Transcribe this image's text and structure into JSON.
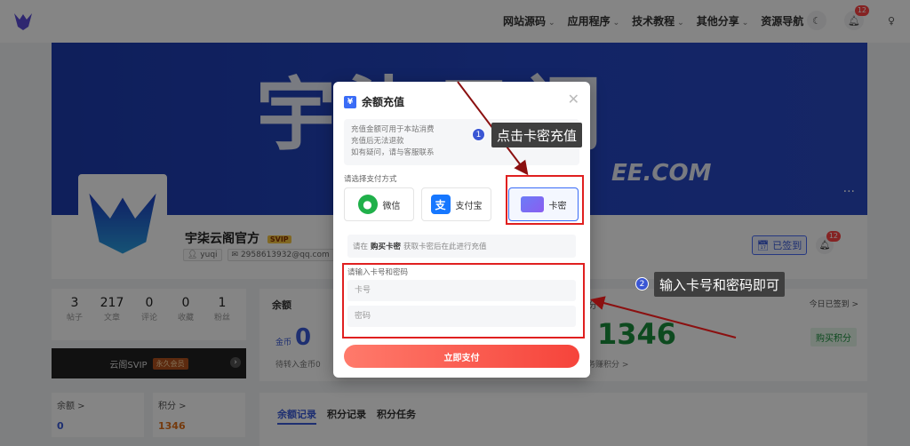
{
  "nav": {
    "menu": [
      "网站源码",
      "应用程序",
      "技术教程",
      "其他分享",
      "资源导航"
    ],
    "notification_count": "12"
  },
  "banner": {
    "title_text": "宇柒云阁",
    "sub_text": "EE.COM"
  },
  "profile": {
    "name": "宇柒云阁官方",
    "vip_label": "SVIP",
    "username": "yuqi",
    "email": "2958613932@qq.com",
    "signed_label": "已签到",
    "bell_count": "12"
  },
  "stats": [
    {
      "value": "3",
      "label": "帖子"
    },
    {
      "value": "217",
      "label": "文章"
    },
    {
      "value": "0",
      "label": "评论"
    },
    {
      "value": "0",
      "label": "收藏"
    },
    {
      "value": "1",
      "label": "粉丝"
    }
  ],
  "svip": {
    "label": "云阁SVIP",
    "tag": "永久会员"
  },
  "mini_cards": {
    "balance_label": "余额 >",
    "balance_value": "0",
    "points_label": "积分 >",
    "points_value": "1346"
  },
  "wallet": {
    "title": "余额",
    "coin_label": "金币",
    "coin_value": "0",
    "coin_sub": "待转入金币0",
    "points_label": "分",
    "points_value": "1346",
    "points_sub": "任务赚积分 >",
    "today": "今日已签到 >",
    "buy": "购买积分"
  },
  "records_tabs": [
    "余额记录",
    "积分记录",
    "积分任务"
  ],
  "modal": {
    "title": "余额充值",
    "notice": [
      "充值金额可用于本站消费",
      "充值后无法退款",
      "如有疑问，请与客服联系"
    ],
    "pay_label": "请选择支付方式",
    "options": [
      {
        "label": "微信",
        "icon": "wechat-icon"
      },
      {
        "label": "支付宝",
        "icon": "alipay-icon"
      },
      {
        "label": "卡密",
        "icon": "card-icon"
      }
    ],
    "tip_before": "请在",
    "tip_link": "购买卡密",
    "tip_after": "获取卡密后在此进行充值",
    "input_label": "请输入卡号和密码",
    "card_placeholder": "卡号",
    "password_placeholder": "密码",
    "pay_button": "立即支付"
  },
  "annotations": {
    "step1_num": "1",
    "step1_text": "点击卡密充值",
    "step2_num": "2",
    "step2_text": "输入卡号和密码即可"
  },
  "colors": {
    "accent": "#3a6cf6",
    "annotation_red": "#e02020",
    "pay_gradient_end": "#f6443b"
  }
}
